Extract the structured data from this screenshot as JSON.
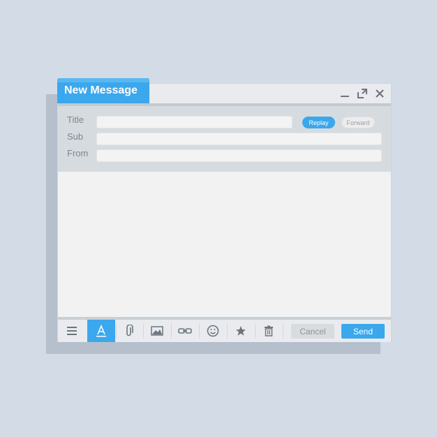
{
  "window": {
    "title": "New Message"
  },
  "form": {
    "title_label": "Title",
    "title_value": "",
    "sub_label": "Sub",
    "sub_value": "",
    "from_label": "From",
    "from_value": "",
    "replay_label": "Replay",
    "forward_label": "Forward"
  },
  "message": {
    "body": ""
  },
  "toolbar": {
    "tools": [
      "menu-icon",
      "text-format-icon",
      "attachment-icon",
      "image-icon",
      "link-icon",
      "emoji-icon",
      "star-icon",
      "trash-icon"
    ],
    "cancel_label": "Cancel",
    "send_label": "Send"
  },
  "colors": {
    "accent": "#3ba7ec",
    "background": "#d2dbe6"
  }
}
